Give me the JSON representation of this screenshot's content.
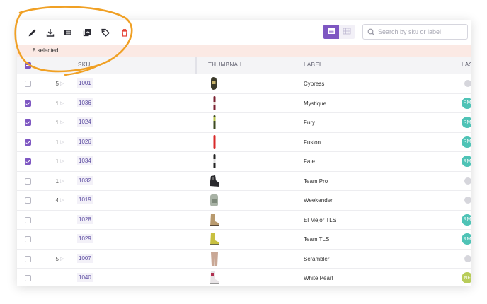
{
  "toolbar": {
    "icons": [
      "edit-icon",
      "download-icon",
      "list-icon",
      "copy-icon",
      "tag-icon",
      "trash-icon"
    ],
    "search_placeholder": "Search by sku or label"
  },
  "selection": {
    "text": "8 selected"
  },
  "columns": {
    "sku": "SKU",
    "thumbnail": "THUMBNAIL",
    "label": "LABEL",
    "last": "LAS"
  },
  "colors": {
    "accent": "#7e57c2",
    "delete": "#e5473c",
    "annotation": "#f0a024",
    "badge_teal": "#4fc3b6",
    "badge_lime": "#b8cc5a"
  },
  "rows": [
    {
      "checked": false,
      "count": "5",
      "sku": "1001",
      "label": "Cypress",
      "thumb": "board-dark",
      "badge": "",
      "badge_color": "gray"
    },
    {
      "checked": true,
      "count": "1",
      "sku": "1036",
      "label": "Mystique",
      "thumb": "board-red",
      "badge": "RM",
      "badge_color": "teal"
    },
    {
      "checked": true,
      "count": "1",
      "sku": "1024",
      "label": "Fury",
      "thumb": "board-green",
      "badge": "RM",
      "badge_color": "teal"
    },
    {
      "checked": true,
      "count": "1",
      "sku": "1026",
      "label": "Fusion",
      "thumb": "board-red2",
      "badge": "RM",
      "badge_color": "teal"
    },
    {
      "checked": true,
      "count": "1",
      "sku": "1034",
      "label": "Fate",
      "thumb": "board-black",
      "badge": "RM",
      "badge_color": "teal"
    },
    {
      "checked": false,
      "count": "1",
      "sku": "1032",
      "label": "Team Pro",
      "thumb": "binding",
      "badge": "",
      "badge_color": "gray"
    },
    {
      "checked": false,
      "count": "4",
      "sku": "1019",
      "label": "Weekender",
      "thumb": "backpack",
      "badge": "",
      "badge_color": "gray"
    },
    {
      "checked": false,
      "count": "",
      "sku": "1028",
      "label": "El Mejor TLS",
      "thumb": "boot-tan",
      "badge": "RM",
      "badge_color": "teal"
    },
    {
      "checked": false,
      "count": "",
      "sku": "1029",
      "label": "Team TLS",
      "thumb": "boot-yellow",
      "badge": "RM",
      "badge_color": "teal"
    },
    {
      "checked": false,
      "count": "5",
      "sku": "1007",
      "label": "Scrambler",
      "thumb": "pants",
      "badge": "",
      "badge_color": "gray"
    },
    {
      "checked": false,
      "count": "",
      "sku": "1040",
      "label": "White Pearl",
      "thumb": "boot-white",
      "badge": "NF",
      "badge_color": "lime"
    },
    {
      "checked": false,
      "count": "",
      "sku": "",
      "label": "",
      "thumb": "partial",
      "badge": "",
      "badge_color": "gray"
    }
  ]
}
